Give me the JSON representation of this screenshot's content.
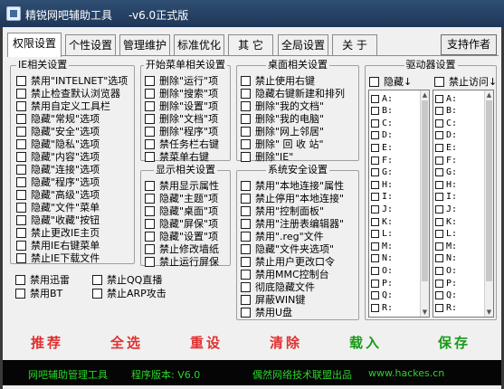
{
  "window": {
    "title": "精锐网吧辅助工具",
    "version": "-v6.0正式版"
  },
  "tabs": [
    "权限设置",
    "个性设置",
    "管理维护",
    "标准优化",
    "其 它",
    "全局设置",
    "关 于"
  ],
  "support_button": "支持作者",
  "groups": {
    "ie": {
      "title": "IE相关设置",
      "items": [
        "禁用\"INTELNET\"选项",
        "禁止检查默认浏览器",
        "禁用自定义工具栏",
        "隐藏\"常规\"选项",
        "隐藏\"安全\"选项",
        "隐藏\"隐私\"选项",
        "隐藏\"内容\"选项",
        "隐藏\"连接\"选项",
        "隐藏\"程序\"选项",
        "隐藏\"高级\"选项",
        "隐藏\"文件\"菜单",
        "隐藏\"收藏\"按钮",
        "禁止更改IE主页",
        "禁用IE右键菜单",
        "禁止IE下载文件"
      ]
    },
    "start_menu": {
      "title": "开始菜单相关设置",
      "items": [
        "删除\"运行\"项",
        "删除\"搜索\"项",
        "删除\"设置\"项",
        "删除\"文档\"项",
        "删除\"程序\"项",
        "禁任务栏右键",
        "禁菜单右键"
      ]
    },
    "desktop": {
      "title": "桌面相关设置",
      "items": [
        "禁止使用右键",
        "隐藏右键新建和排列",
        "删除\"我的文档\"",
        "删除\"我的电脑\"",
        "删除\"网上邻居\"",
        "删除\" 回 收 站\"",
        "删除\"IE\""
      ]
    },
    "display": {
      "title": "显示相关设置",
      "items": [
        "禁用显示属性",
        "隐藏\"主题\"项",
        "隐藏\"桌面\"项",
        "隐藏\"屏保\"项",
        "隐藏\"设置\"项",
        "禁止修改墙纸",
        "禁止运行屏保"
      ]
    },
    "security": {
      "title": "系统安全设置",
      "items": [
        "禁用\"本地连接\"属性",
        "禁止停用\"本地连接\"",
        "禁用\"控制面板\"",
        "禁用\"注册表编辑器\"",
        "禁用\".reg\"文件",
        "隐藏\"文件夹选项\"",
        "禁止用户更改口令",
        "禁用MMC控制台",
        "彻底隐藏文件",
        "屏蔽WIN键",
        "禁用U盘"
      ]
    },
    "misc": {
      "items": [
        "禁用迅雷",
        "禁止QQ直播",
        "禁用BT",
        "禁止ARP攻击"
      ]
    },
    "drives": {
      "title": "驱动器设置",
      "hide_label": "隐藏↓",
      "deny_label": "禁止访问↓",
      "letters": [
        "A:",
        "B:",
        "C:",
        "D:",
        "E:",
        "F:",
        "G:",
        "H:",
        "I:",
        "J:",
        "K:",
        "L:",
        "M:",
        "N:",
        "O:",
        "P:",
        "Q:",
        "R:"
      ]
    }
  },
  "actions": [
    {
      "label": "推荐",
      "color": "#e03030"
    },
    {
      "label": "全选",
      "color": "#e03030"
    },
    {
      "label": "重设",
      "color": "#e03030"
    },
    {
      "label": "清除",
      "color": "#e03030"
    },
    {
      "label": "载入",
      "color": "#189a18"
    },
    {
      "label": "保存",
      "color": "#189a18"
    }
  ],
  "footer": {
    "app_name": "网吧辅助管理工具",
    "version_label": "程序版本: V6.0",
    "credit": "偶然网络技术联盟出品",
    "website": "www.hackes.cn"
  }
}
